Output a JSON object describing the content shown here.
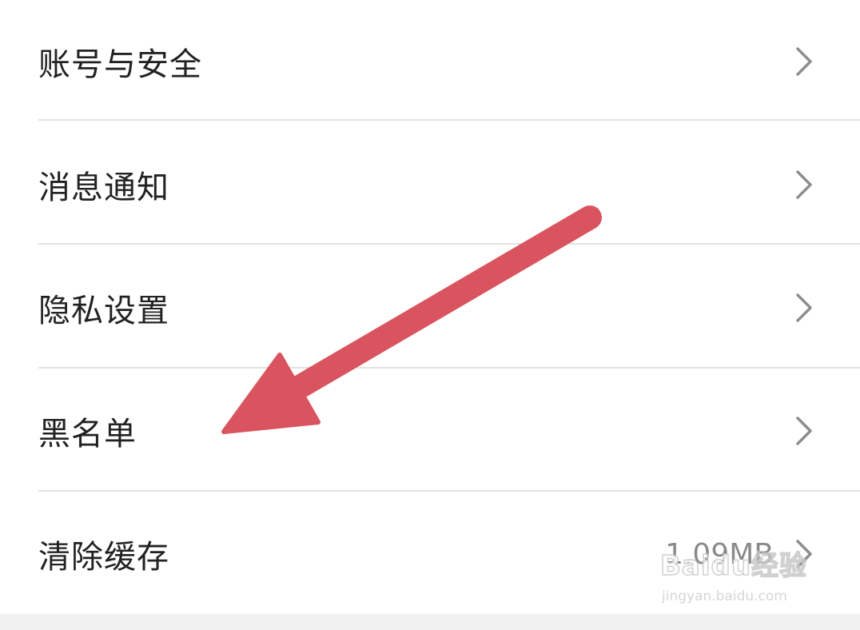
{
  "settings": {
    "items": [
      {
        "label": "账号与安全",
        "value": ""
      },
      {
        "label": "消息通知",
        "value": ""
      },
      {
        "label": "隐私设置",
        "value": ""
      },
      {
        "label": "黑名单",
        "value": ""
      },
      {
        "label": "清除缓存",
        "value": "1.09MB"
      }
    ],
    "chevron_icon": "chevron-right-icon"
  },
  "annotation": {
    "type": "red-arrow",
    "color": "#d9545e",
    "points_to": "黑名单"
  },
  "watermark": {
    "logo_text": "Baidu经验",
    "url_text": "jingyan.baidu.com"
  },
  "colors": {
    "background": "#ffffff",
    "text": "#222222",
    "secondary_text": "#8a8a8a",
    "divider": "#e2e2e2",
    "chevron": "#8e8e8e"
  }
}
